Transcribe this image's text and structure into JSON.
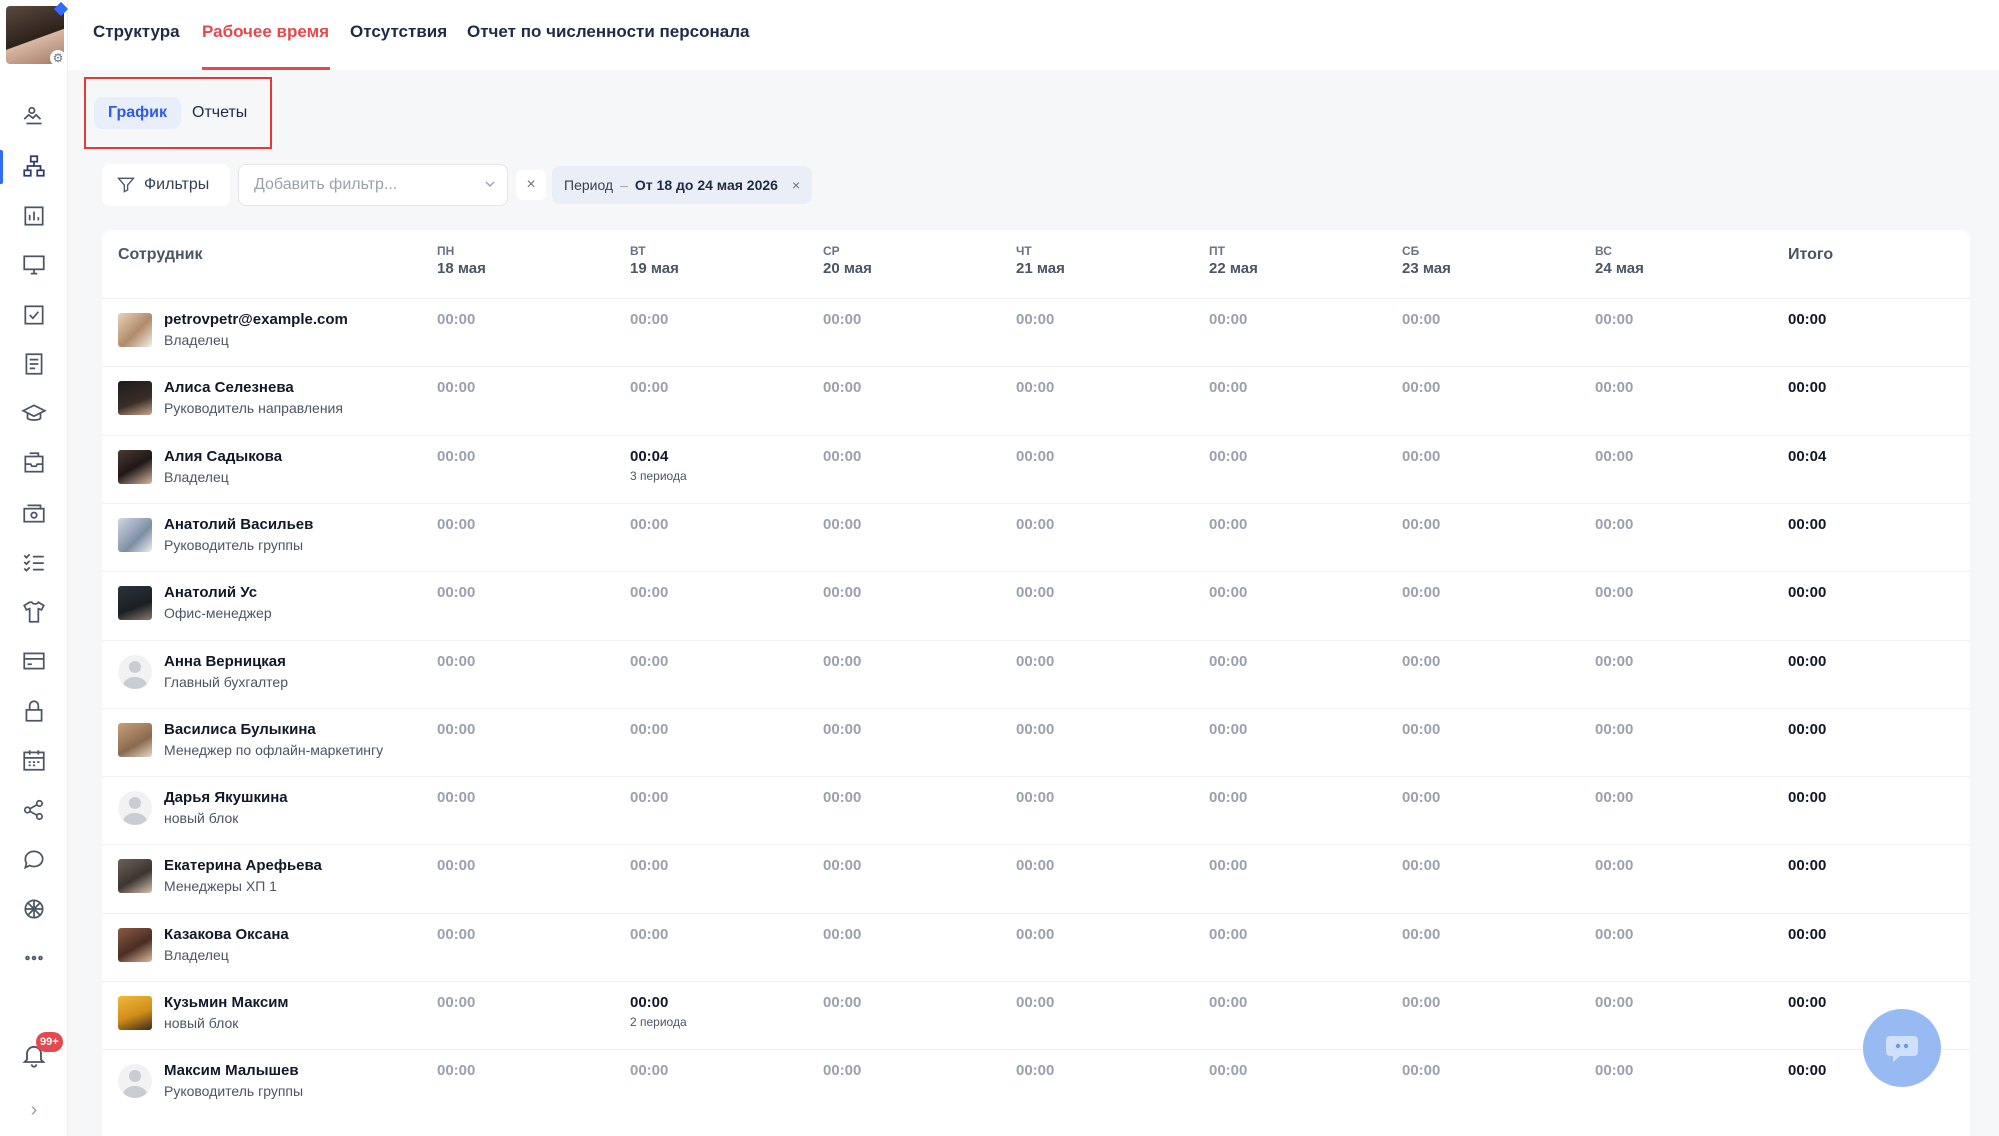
{
  "nav": {
    "tabs": [
      {
        "label": "Структура",
        "active": false
      },
      {
        "label": "Рабочее время",
        "active": true
      },
      {
        "label": "Отсутствия",
        "active": false
      },
      {
        "label": "Отчет по численности персонала",
        "active": false
      }
    ]
  },
  "subtabs": [
    {
      "label": "График",
      "active": true
    },
    {
      "label": "Отчеты",
      "active": false
    }
  ],
  "filters": {
    "button_label": "Фильтры",
    "add_placeholder": "Добавить фильтр...",
    "clear_symbol": "×",
    "period_label": "Период",
    "period_sep": "–",
    "period_value": "От 18 до 24 мая 2026",
    "period_remove": "×"
  },
  "table": {
    "employee_header": "Сотрудник",
    "total_header": "Итого",
    "days": [
      {
        "dow": "ПН",
        "date": "18 мая"
      },
      {
        "dow": "ВТ",
        "date": "19 мая"
      },
      {
        "dow": "СР",
        "date": "20 мая"
      },
      {
        "dow": "ЧТ",
        "date": "21 мая"
      },
      {
        "dow": "ПТ",
        "date": "22 мая"
      },
      {
        "dow": "СБ",
        "date": "23 мая"
      },
      {
        "dow": "ВС",
        "date": "24 мая"
      }
    ],
    "rows": [
      {
        "name": "petrovpetr@example.com",
        "role": "Владелец",
        "cells": [
          "00:00",
          "00:00",
          "00:00",
          "00:00",
          "00:00",
          "00:00",
          "00:00"
        ],
        "subs": [
          "",
          "",
          "",
          "",
          "",
          "",
          ""
        ],
        "total": "00:00"
      },
      {
        "name": "Алиса Селезнева",
        "role": "Руководитель направления",
        "cells": [
          "00:00",
          "00:00",
          "00:00",
          "00:00",
          "00:00",
          "00:00",
          "00:00"
        ],
        "subs": [
          "",
          "",
          "",
          "",
          "",
          "",
          ""
        ],
        "total": "00:00"
      },
      {
        "name": "Алия Садыкова",
        "role": "Владелец",
        "cells": [
          "00:00",
          "00:04",
          "00:00",
          "00:00",
          "00:00",
          "00:00",
          "00:00"
        ],
        "subs": [
          "",
          "3 периода",
          "",
          "",
          "",
          "",
          ""
        ],
        "total": "00:04"
      },
      {
        "name": "Анатолий Васильев",
        "role": "Руководитель группы",
        "cells": [
          "00:00",
          "00:00",
          "00:00",
          "00:00",
          "00:00",
          "00:00",
          "00:00"
        ],
        "subs": [
          "",
          "",
          "",
          "",
          "",
          "",
          ""
        ],
        "total": "00:00"
      },
      {
        "name": "Анатолий Ус",
        "role": "Офис-менеджер",
        "cells": [
          "00:00",
          "00:00",
          "00:00",
          "00:00",
          "00:00",
          "00:00",
          "00:00"
        ],
        "subs": [
          "",
          "",
          "",
          "",
          "",
          "",
          ""
        ],
        "total": "00:00"
      },
      {
        "name": "Анна Верницкая",
        "role": "Главный бухгалтер",
        "cells": [
          "00:00",
          "00:00",
          "00:00",
          "00:00",
          "00:00",
          "00:00",
          "00:00"
        ],
        "subs": [
          "",
          "",
          "",
          "",
          "",
          "",
          ""
        ],
        "total": "00:00"
      },
      {
        "name": "Василиса Булыкина",
        "role": "Менеджер по офлайн-маркетингу",
        "cells": [
          "00:00",
          "00:00",
          "00:00",
          "00:00",
          "00:00",
          "00:00",
          "00:00"
        ],
        "subs": [
          "",
          "",
          "",
          "",
          "",
          "",
          ""
        ],
        "total": "00:00"
      },
      {
        "name": "Дарья Якушкина",
        "role": "новый блок",
        "cells": [
          "00:00",
          "00:00",
          "00:00",
          "00:00",
          "00:00",
          "00:00",
          "00:00"
        ],
        "subs": [
          "",
          "",
          "",
          "",
          "",
          "",
          ""
        ],
        "total": "00:00"
      },
      {
        "name": "Екатерина Арефьева",
        "role": "Менеджеры ХП 1",
        "cells": [
          "00:00",
          "00:00",
          "00:00",
          "00:00",
          "00:00",
          "00:00",
          "00:00"
        ],
        "subs": [
          "",
          "",
          "",
          "",
          "",
          "",
          ""
        ],
        "total": "00:00"
      },
      {
        "name": "Казакова Оксана",
        "role": "Владелец",
        "cells": [
          "00:00",
          "00:00",
          "00:00",
          "00:00",
          "00:00",
          "00:00",
          "00:00"
        ],
        "subs": [
          "",
          "",
          "",
          "",
          "",
          "",
          ""
        ],
        "total": "00:00"
      },
      {
        "name": "Кузьмин Максим",
        "role": "новый блок",
        "cells": [
          "00:00",
          "00:00",
          "00:00",
          "00:00",
          "00:00",
          "00:00",
          "00:00"
        ],
        "subs": [
          "",
          "2 периода",
          "",
          "",
          "",
          "",
          ""
        ],
        "total": "00:00"
      },
      {
        "name": "Максим Малышев",
        "role": "Руководитель группы",
        "cells": [
          "00:00",
          "00:00",
          "00:00",
          "00:00",
          "00:00",
          "00:00",
          "00:00"
        ],
        "subs": [
          "",
          "",
          "",
          "",
          "",
          "",
          ""
        ],
        "total": "00:00"
      }
    ]
  },
  "notifications": {
    "badge": "99+"
  },
  "sidebar": {
    "icons": [
      "handshake-icon",
      "org-structure-icon",
      "bar-chart-icon",
      "monitor-icon",
      "checkbox-icon",
      "document-icon",
      "graduation-cap-icon",
      "inbox-icon",
      "cash-register-icon",
      "checklist-icon",
      "tshirt-icon",
      "credit-card-icon",
      "lock-icon",
      "calendar-icon",
      "share-nodes-icon",
      "chat-bubble-icon",
      "ai-spark-icon",
      "more-dots-icon"
    ],
    "collapse_symbol": "›"
  },
  "colors": {
    "accent_red": "#e5484d",
    "accent_blue": "#2f5be0",
    "highlight_box": "#e53935"
  }
}
